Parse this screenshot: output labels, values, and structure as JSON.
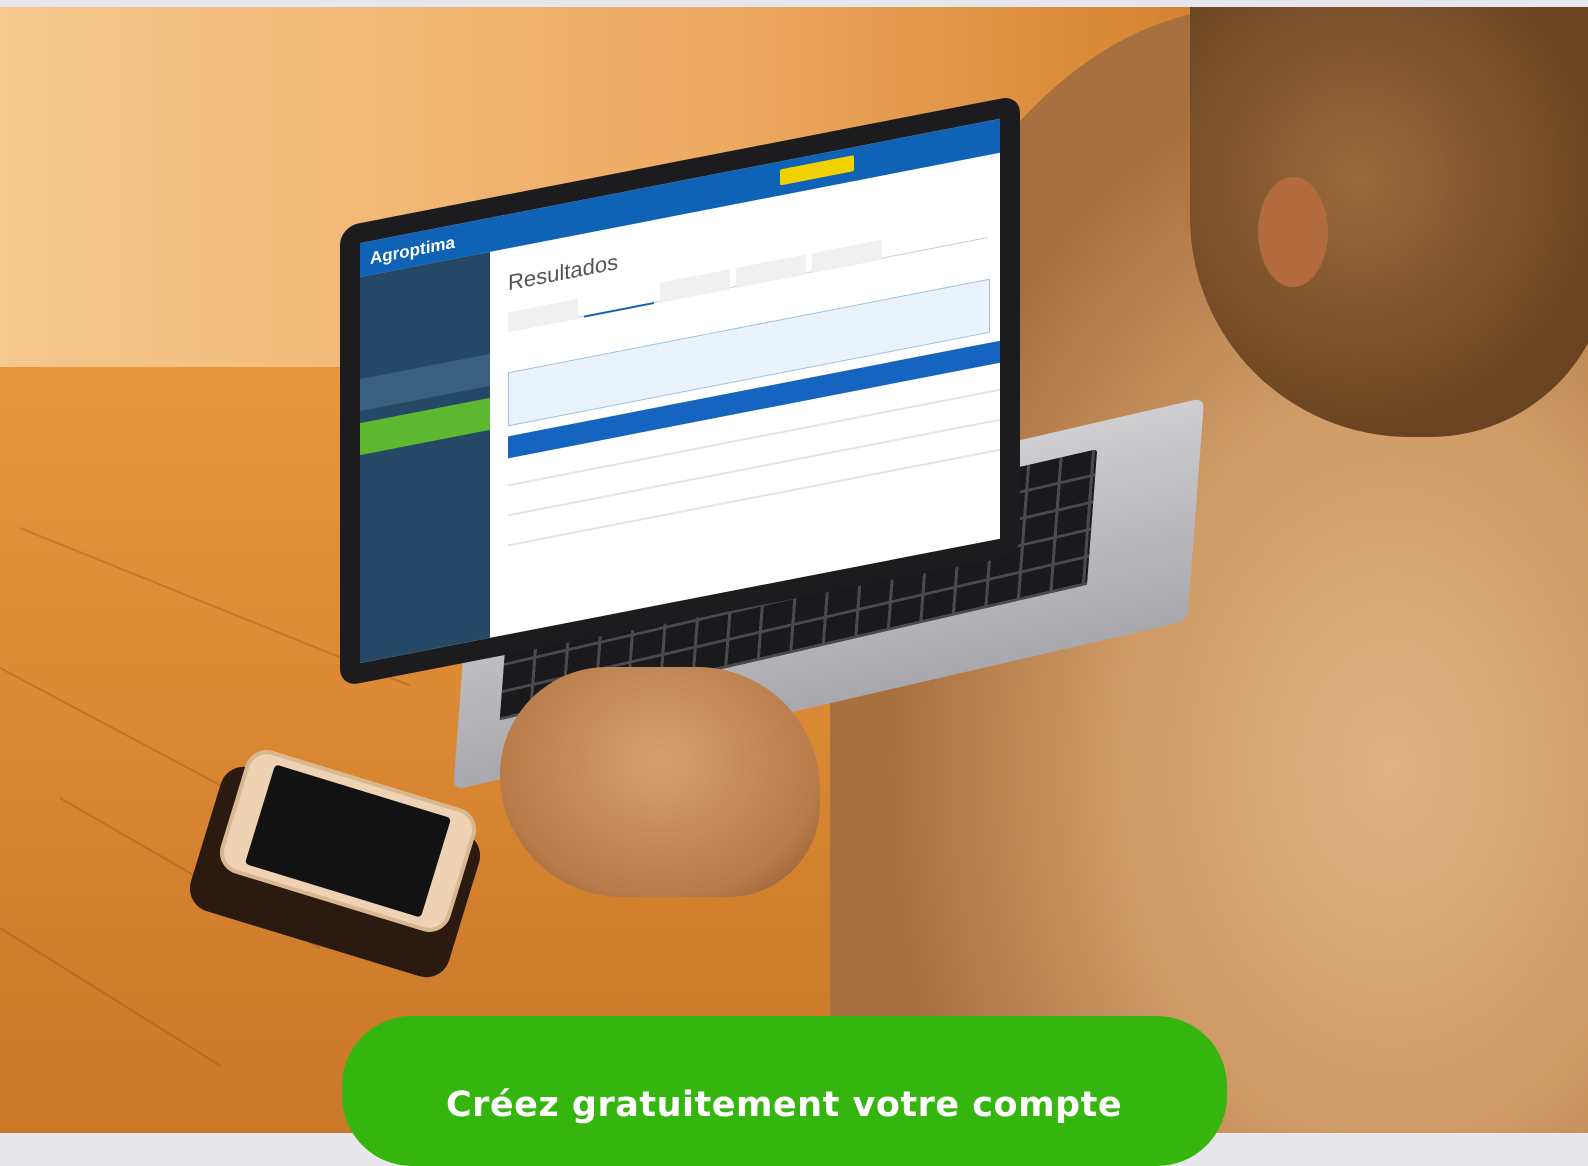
{
  "cta": {
    "label": "Créez gratuitement votre compte",
    "color": "#35b60f"
  },
  "screen_app": {
    "title": "Resultados",
    "brand": "Agroptima"
  }
}
